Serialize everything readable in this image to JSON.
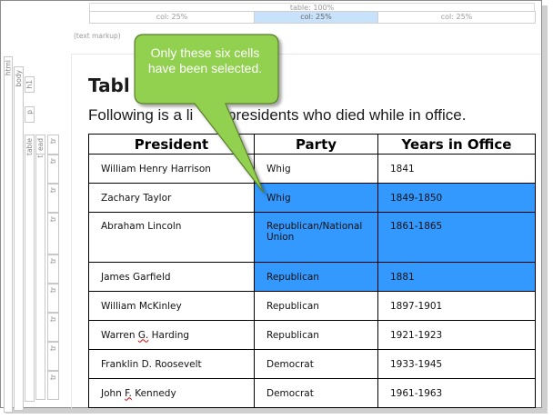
{
  "rulers": {
    "table_label": "table: 100%",
    "cols": [
      "col: 25%",
      "col: 25%",
      "col: 25%"
    ]
  },
  "text_markup": "(text markup)",
  "tags": [
    "html",
    "body",
    "h1",
    "p",
    "table",
    "tbody",
    "ead",
    "tr",
    "tr",
    "tr",
    "tr",
    "tr",
    "tr",
    "tr",
    "tr",
    "tr"
  ],
  "heading": "Tabl",
  "paragraph": "Following is a li      f presidents who died while in office.",
  "callout": {
    "line1": "Only these six cells",
    "line2": "have been selected."
  },
  "colors": {
    "selection": "#3399ff",
    "callout_fill": "#92d050",
    "ruler_selected": "#c8e2fb"
  },
  "table": {
    "headers": [
      "President",
      "Party",
      "Years in Office"
    ],
    "rows": [
      {
        "president": "William Henry Harrison",
        "party": "Whig",
        "years": "1841"
      },
      {
        "president": "Zachary Taylor",
        "party": "Whig",
        "years": "1849-1850"
      },
      {
        "president": "Abraham Lincoln",
        "party": "Republican/National Union",
        "years": "1861-1865"
      },
      {
        "president": "James Garfield",
        "party": "Republican",
        "years": "1881"
      },
      {
        "president": "William McKinley",
        "party": "Republican",
        "years": "1897-1901"
      },
      {
        "president": "Warren G. Harding",
        "party": "Republican",
        "years": "1921-1923"
      },
      {
        "president": "Franklin D. Roosevelt",
        "party": "Democrat",
        "years": "1933-1945"
      },
      {
        "president": "John F. Kennedy",
        "party": "Democrat",
        "years": "1961-1963"
      }
    ]
  }
}
